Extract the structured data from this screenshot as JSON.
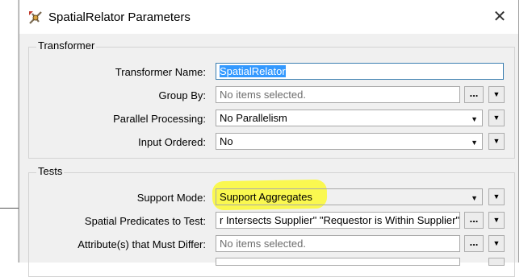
{
  "window": {
    "title": "SpatialRelator Parameters",
    "close_glyph": "✕"
  },
  "transformer_group": {
    "title": "Transformer",
    "fields": {
      "name": {
        "label": "Transformer Name:",
        "value": "SpatialRelator"
      },
      "group_by": {
        "label": "Group By:",
        "placeholder": "No items selected.",
        "button": "..."
      },
      "parallel": {
        "label": "Parallel Processing:",
        "value": "No Parallelism"
      },
      "input_ordered": {
        "label": "Input Ordered:",
        "value": "No"
      }
    }
  },
  "tests_group": {
    "title": "Tests",
    "fields": {
      "support_mode": {
        "label": "Support Mode:",
        "value": "Support Aggregates"
      },
      "spatial_predicates": {
        "label": "Spatial Predicates to Test:",
        "value": "r Intersects Supplier\" \"Requestor is Within Supplier\"",
        "button": "..."
      },
      "must_differ": {
        "label": "Attribute(s) that Must Differ:",
        "placeholder": "No items selected.",
        "button": "..."
      }
    }
  },
  "icons": {
    "app": "spatialrelator-icon",
    "dropdown": "chevron-down-icon",
    "menu": "triangle-down-icon"
  },
  "colors": {
    "highlight": "#fcfa28",
    "selection": "#3399ff"
  }
}
